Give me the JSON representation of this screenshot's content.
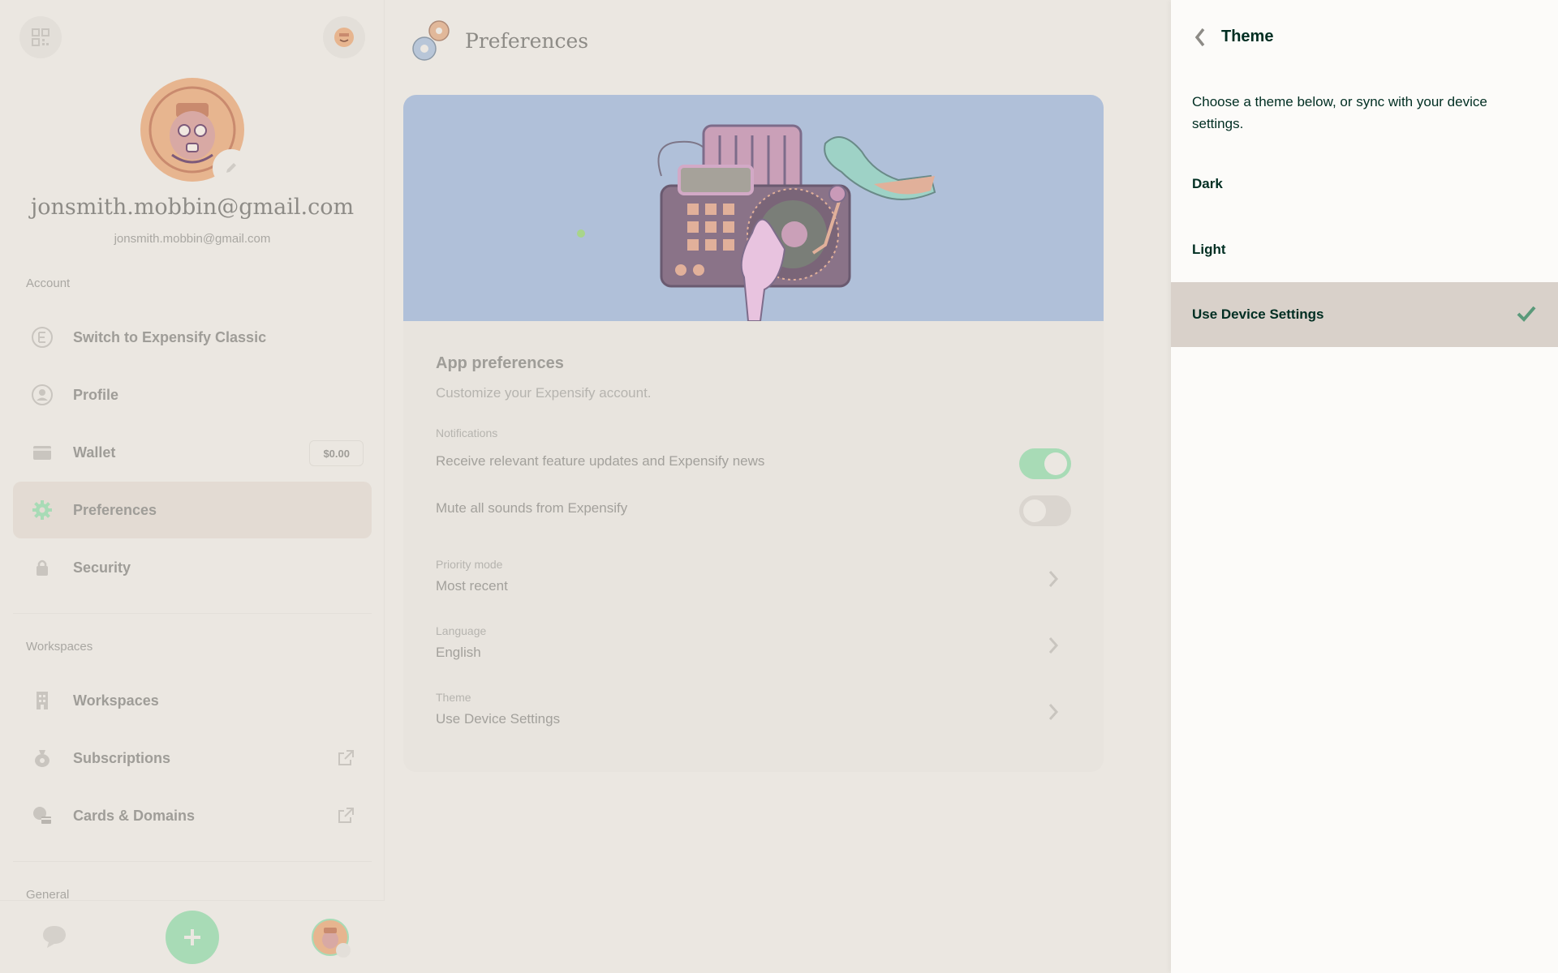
{
  "sidebar": {
    "display_name": "jonsmith.mobbin@gmail.com",
    "email": "jonsmith.mobbin@gmail.com",
    "account_label": "Account",
    "account_items": [
      {
        "label": "Switch to Expensify Classic",
        "icon": "expensify-classic-icon"
      },
      {
        "label": "Profile",
        "icon": "profile-icon"
      },
      {
        "label": "Wallet",
        "icon": "wallet-icon",
        "badge": "$0.00"
      },
      {
        "label": "Preferences",
        "icon": "gear-icon",
        "active": true
      },
      {
        "label": "Security",
        "icon": "lock-icon"
      }
    ],
    "workspaces_label": "Workspaces",
    "workspace_items": [
      {
        "label": "Workspaces",
        "icon": "building-icon"
      },
      {
        "label": "Subscriptions",
        "icon": "money-bag-icon",
        "external": true
      },
      {
        "label": "Cards & Domains",
        "icon": "globe-card-icon",
        "external": true
      }
    ],
    "general_label": "General"
  },
  "header": {
    "title": "Preferences"
  },
  "preferences": {
    "title": "App preferences",
    "subtitle": "Customize your Expensify account.",
    "notifications_label": "Notifications",
    "toggles": [
      {
        "label": "Receive relevant feature updates and Expensify news",
        "on": true
      },
      {
        "label": "Mute all sounds from Expensify",
        "on": false
      }
    ],
    "rows": [
      {
        "label": "Priority mode",
        "value": "Most recent"
      },
      {
        "label": "Language",
        "value": "English"
      },
      {
        "label": "Theme",
        "value": "Use Device Settings"
      }
    ]
  },
  "panel": {
    "title": "Theme",
    "description": "Choose a theme below, or sync with your device settings.",
    "options": [
      {
        "label": "Dark",
        "selected": false
      },
      {
        "label": "Light",
        "selected": false
      },
      {
        "label": "Use Device Settings",
        "selected": true
      }
    ]
  },
  "colors": {
    "accent_green": "#03d47c",
    "check_green": "#5a9a7a",
    "toggle_on": "#a8dbb6",
    "toggle_off": "#dad5cf",
    "hero_bg": "#b0c0d9"
  }
}
